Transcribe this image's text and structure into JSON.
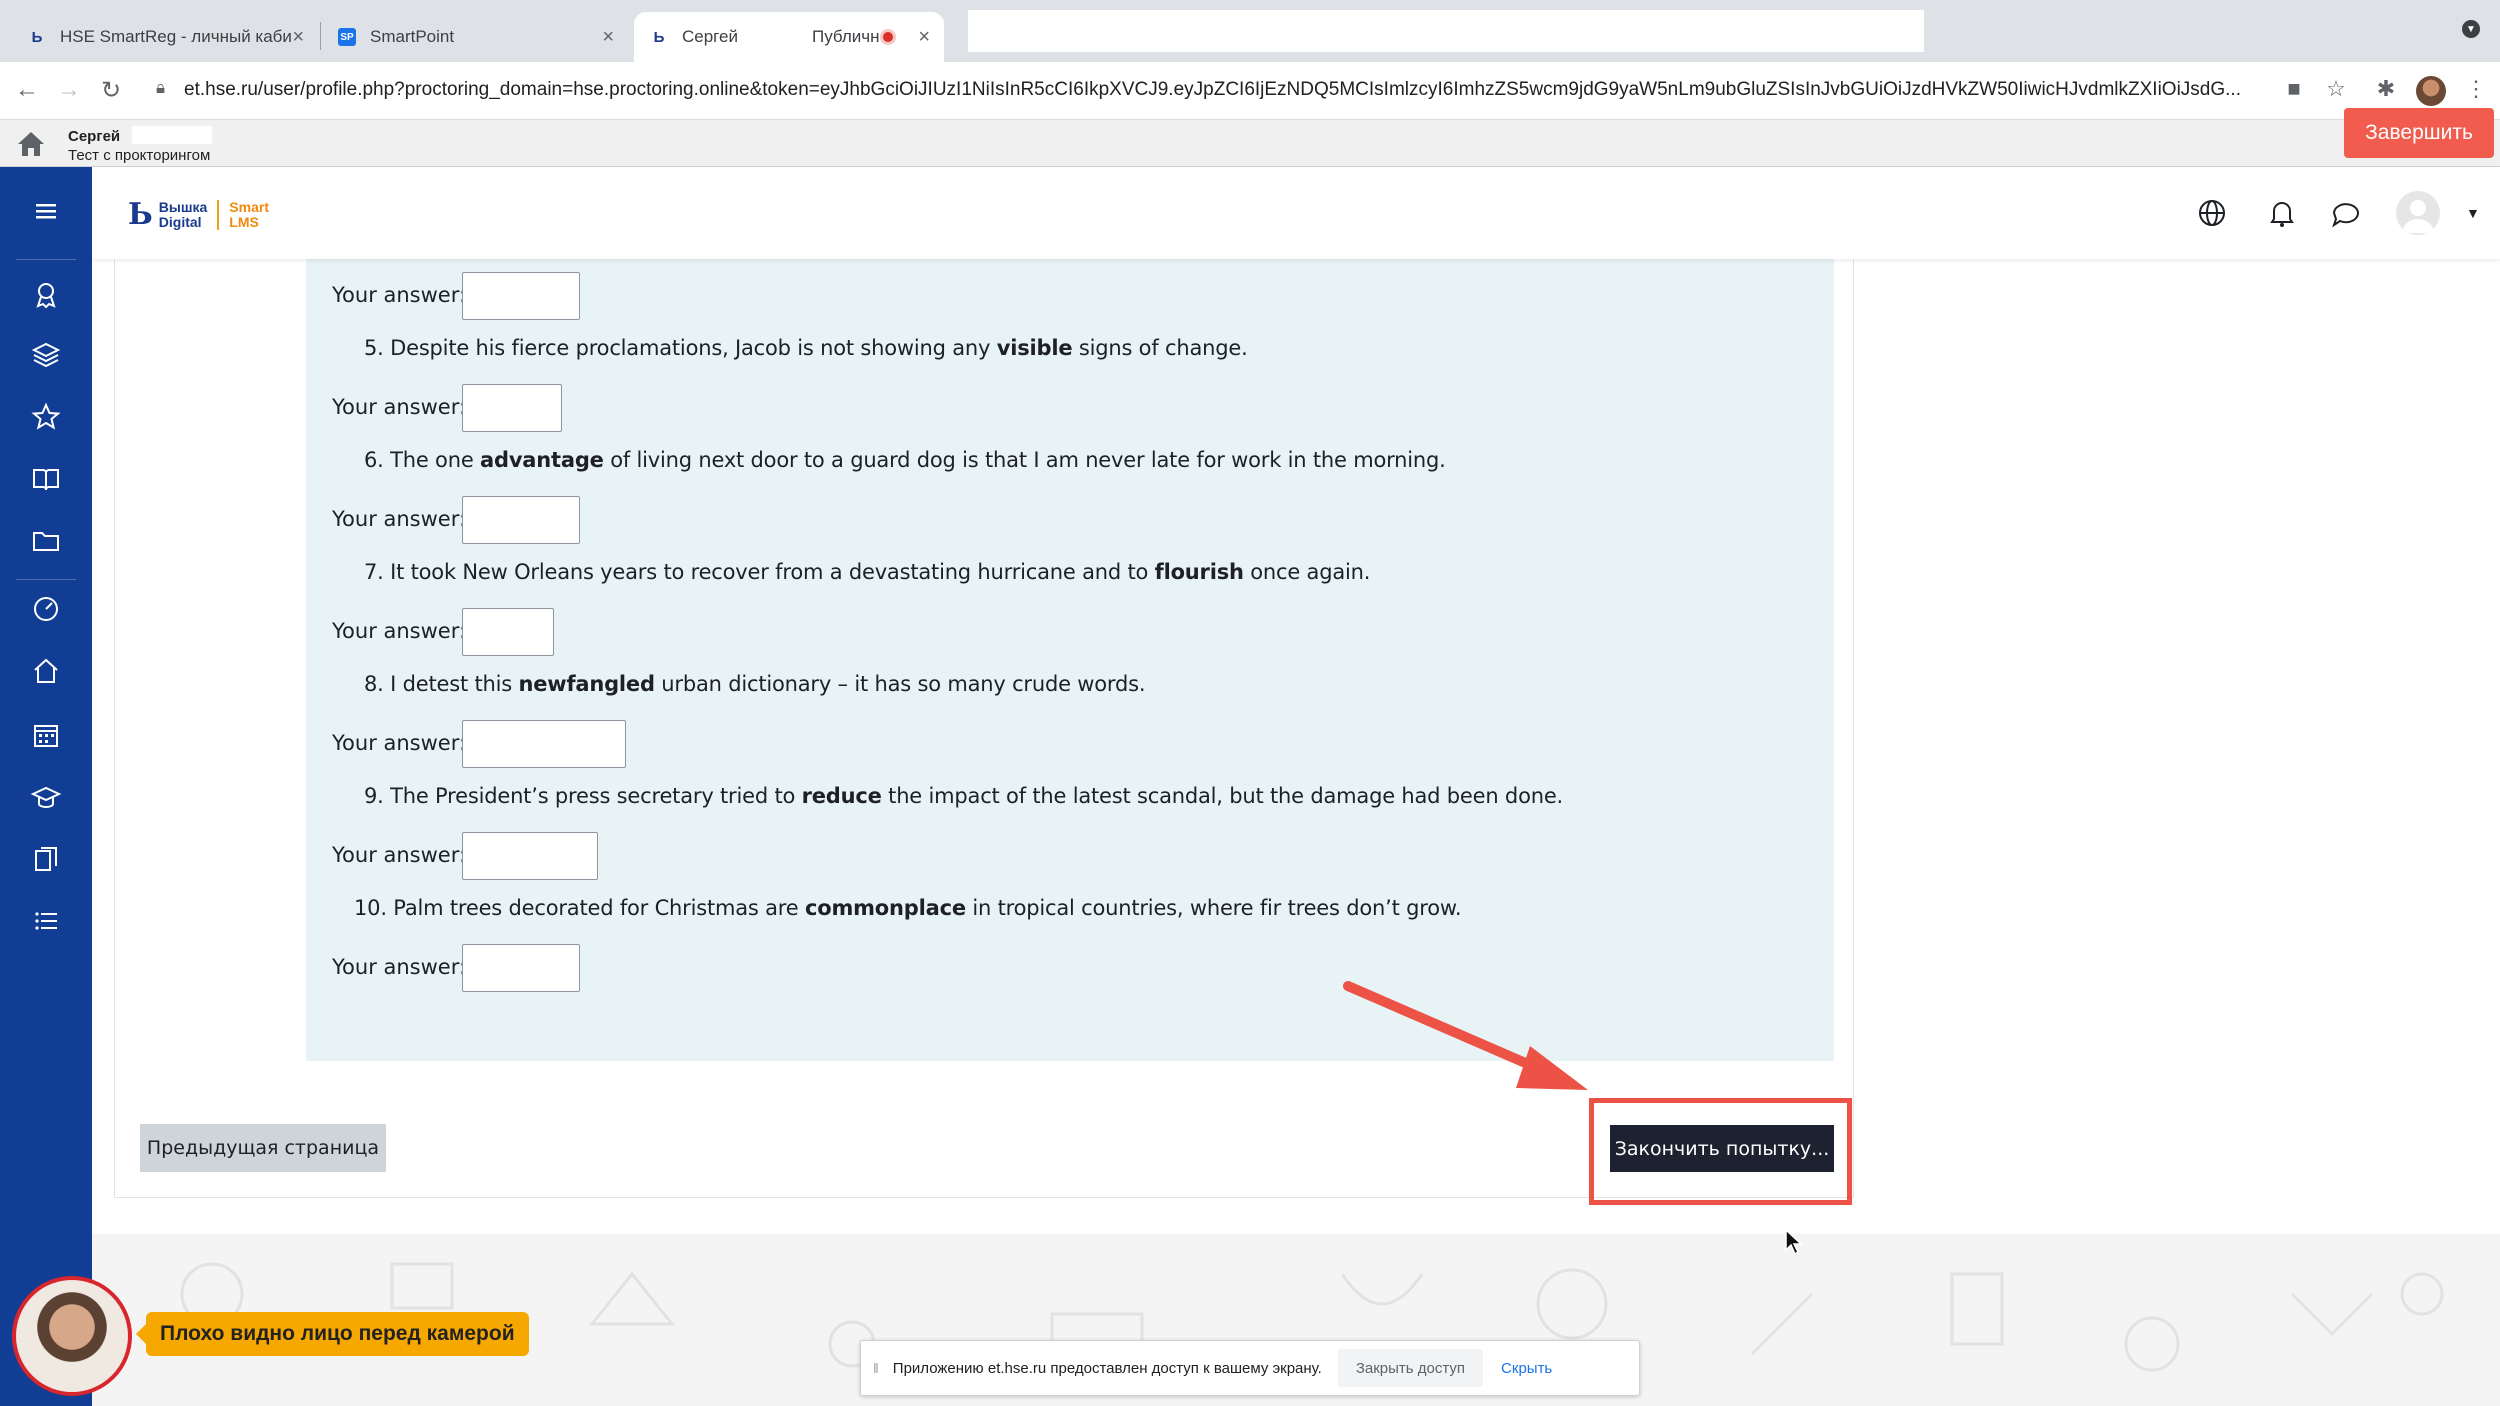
{
  "browser": {
    "tabs": [
      {
        "title": "HSE SmartReg - личный кабин",
        "icon": "hse-icon"
      },
      {
        "title": "SmartPoint",
        "icon": "sp-icon",
        "icon_text": "SP"
      },
      {
        "title": "Сергей",
        "title2": "Публичн",
        "icon": "hse-icon"
      }
    ],
    "url": "et.hse.ru/user/profile.php?proctoring_domain=hse.proctoring.online&token=eyJhbGciOiJIUzI1NiIsInR5cCI6IkpXVCJ9.eyJpZCI6IjEzNDQ5MCIsImlzcyI6ImhzZS5wcm9jdG9yaW5nLm9ubGluZSIsInJvbGUiOiJzdHVkZW50IiwicHJvdmlkZXIiOiJsdG..."
  },
  "proctoring": {
    "name": "Сергей",
    "subtitle": "Тест с прокторингом",
    "finish_label": "Завершить"
  },
  "header": {
    "logo_line1": "Вышка",
    "logo_line2": "Digital",
    "logo_brand1": "Smart",
    "logo_brand2": "LMS"
  },
  "questions": [
    {
      "number": "5.",
      "pre": "Despite his fierce proclamations, Jacob is not showing any ",
      "word": "visible",
      "post": " signs of change."
    },
    {
      "number": "6.",
      "pre": "The one ",
      "word": "advantage",
      "post": " of living next door to a guard dog is that I am never late for work in the morning."
    },
    {
      "number": "7.",
      "pre": "It took New Orleans years to recover from a devastating hurricane and to ",
      "word": "flourish",
      "post": " once again."
    },
    {
      "number": "8.",
      "pre": "I detest this ",
      "word": "newfangled",
      "post": " urban dictionary – it has so many crude words."
    },
    {
      "number": "9.",
      "pre": "The President’s press secretary tried to ",
      "word": "reduce",
      "post": " the impact of the latest scandal, but the damage had been done."
    },
    {
      "number": "10.",
      "pre": "Palm trees decorated for Christmas are ",
      "word": "commonplace",
      "post": " in tropical countries, where fir trees don’t grow."
    }
  ],
  "answer_label": "Your answer:",
  "answers": [
    "",
    "",
    "",
    "",
    "",
    "",
    ""
  ],
  "buttons": {
    "previous": "Предыдущая страница",
    "finish_attempt": "Закончить попытку..."
  },
  "camera": {
    "warning": "Плохо видно лицо перед камерой"
  },
  "screen_share": {
    "message": "Приложению et.hse.ru предоставлен доступ к вашему экрану.",
    "stop_label": "Закрыть доступ",
    "hide_label": "Скрыть"
  },
  "colors": {
    "sidebar": "#123d95",
    "formulation_bg": "#e7f3f5",
    "finish_red": "#f25c4f",
    "highlight_red": "#ec5246",
    "primary_dark": "#1e2230",
    "warning_yellow": "#f7a800"
  }
}
